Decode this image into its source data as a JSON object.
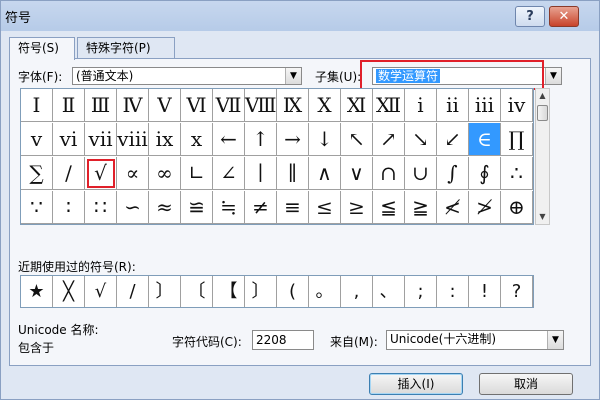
{
  "window": {
    "title": "符号",
    "help_label": "?",
    "close_label": "✕"
  },
  "tabs": [
    {
      "label": "符号(S)"
    },
    {
      "label": "特殊字符(P)"
    }
  ],
  "font": {
    "label": "字体(F):",
    "value": "(普通文本)"
  },
  "subset": {
    "label": "子集(U):",
    "value": "数学运算符"
  },
  "symbol_grid": [
    [
      "Ⅰ",
      "Ⅱ",
      "Ⅲ",
      "Ⅳ",
      "Ⅴ",
      "Ⅵ",
      "Ⅶ",
      "Ⅷ",
      "Ⅸ",
      "Ⅹ",
      "Ⅺ",
      "Ⅻ",
      "ⅰ",
      "ⅱ",
      "ⅲ",
      "ⅳ"
    ],
    [
      "ⅴ",
      "ⅵ",
      "ⅶ",
      "ⅷ",
      "ⅸ",
      "ⅹ",
      "←",
      "↑",
      "→",
      "↓",
      "↖",
      "↗",
      "↘",
      "↙",
      "∈",
      "∏"
    ],
    [
      "∑",
      "∕",
      "√",
      "∝",
      "∞",
      "∟",
      "∠",
      "∣",
      "∥",
      "∧",
      "∨",
      "∩",
      "∪",
      "∫",
      "∮",
      "∴"
    ],
    [
      "∵",
      "∶",
      "∷",
      "∽",
      "≈",
      "≌",
      "≒",
      "≠",
      "≡",
      "≤",
      "≥",
      "≦",
      "≧",
      "≮",
      "≯",
      "⊕"
    ]
  ],
  "selected_symbol": "∈",
  "highlighted_symbol": "√",
  "recent": {
    "label": "近期使用过的符号(R):",
    "symbols": [
      "★",
      "╳",
      "√",
      "/",
      "〕",
      "〔",
      "【",
      "〕",
      "(",
      "。",
      ",",
      "、",
      ";",
      ":",
      "!",
      "?"
    ]
  },
  "unicode_name": {
    "label": "Unicode 名称:",
    "value": "包含于"
  },
  "char_code": {
    "label": "字符代码(C):",
    "value": "2208"
  },
  "from": {
    "label": "来自(M):",
    "value": "Unicode(十六进制)"
  },
  "buttons": {
    "insert": "插入(I)",
    "cancel": "取消"
  },
  "colors": {
    "selection": "#3399ff",
    "annotation_red": "#e0202a"
  }
}
